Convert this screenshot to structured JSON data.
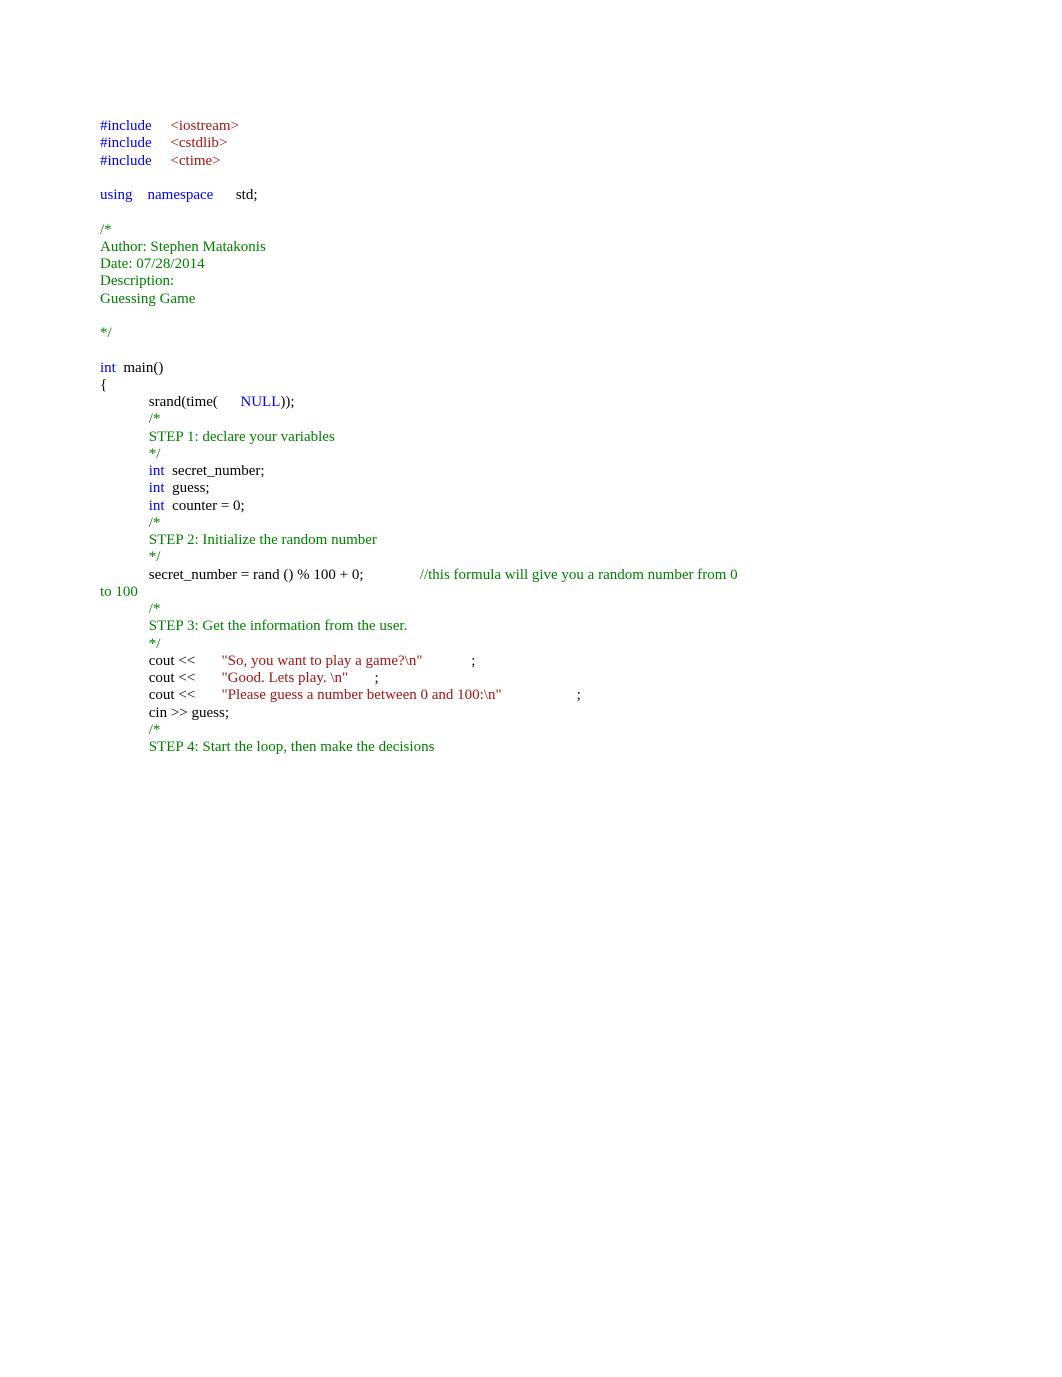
{
  "lines": [
    {
      "segments": [
        {
          "text": "#include",
          "class": "blue"
        },
        {
          "text": "     ",
          "class": "black"
        },
        {
          "text": "<iostream>",
          "class": "red"
        }
      ]
    },
    {
      "segments": [
        {
          "text": "#include",
          "class": "blue"
        },
        {
          "text": "     ",
          "class": "black"
        },
        {
          "text": "<cstdlib>",
          "class": "red"
        }
      ]
    },
    {
      "segments": [
        {
          "text": "#include",
          "class": "blue"
        },
        {
          "text": "     ",
          "class": "black"
        },
        {
          "text": "<ctime>",
          "class": "red"
        }
      ]
    },
    {
      "segments": [
        {
          "text": " ",
          "class": "black"
        }
      ]
    },
    {
      "segments": [
        {
          "text": "using",
          "class": "blue"
        },
        {
          "text": "    ",
          "class": "black"
        },
        {
          "text": "namespace",
          "class": "blue"
        },
        {
          "text": "      std;",
          "class": "black"
        }
      ]
    },
    {
      "segments": [
        {
          "text": " ",
          "class": "black"
        }
      ]
    },
    {
      "segments": [
        {
          "text": "/*",
          "class": "green"
        }
      ]
    },
    {
      "segments": [
        {
          "text": "Author: Stephen Matakonis",
          "class": "green"
        }
      ]
    },
    {
      "segments": [
        {
          "text": "Date: 07/28/2014",
          "class": "green"
        }
      ]
    },
    {
      "segments": [
        {
          "text": "Description:",
          "class": "green"
        }
      ]
    },
    {
      "segments": [
        {
          "text": "Guessing Game",
          "class": "green"
        }
      ]
    },
    {
      "segments": [
        {
          "text": " ",
          "class": "black"
        }
      ]
    },
    {
      "segments": [
        {
          "text": "*/",
          "class": "green"
        }
      ]
    },
    {
      "segments": [
        {
          "text": " ",
          "class": "black"
        }
      ]
    },
    {
      "segments": [
        {
          "text": "int",
          "class": "blue"
        },
        {
          "text": "  main()",
          "class": "black"
        }
      ]
    },
    {
      "segments": [
        {
          "text": "{",
          "class": "black"
        }
      ]
    },
    {
      "segments": [
        {
          "text": "             srand(time(      ",
          "class": "black"
        },
        {
          "text": "NULL",
          "class": "blue"
        },
        {
          "text": "));",
          "class": "black"
        }
      ]
    },
    {
      "segments": [
        {
          "text": "             ",
          "class": "black"
        },
        {
          "text": "/*",
          "class": "green"
        }
      ]
    },
    {
      "segments": [
        {
          "text": "             ",
          "class": "black"
        },
        {
          "text": "STEP 1: declare your variables",
          "class": "green"
        }
      ]
    },
    {
      "segments": [
        {
          "text": "             ",
          "class": "black"
        },
        {
          "text": "*/",
          "class": "green"
        }
      ]
    },
    {
      "segments": [
        {
          "text": "             ",
          "class": "black"
        },
        {
          "text": "int",
          "class": "blue"
        },
        {
          "text": "  secret_number;",
          "class": "black"
        }
      ]
    },
    {
      "segments": [
        {
          "text": "             ",
          "class": "black"
        },
        {
          "text": "int",
          "class": "blue"
        },
        {
          "text": "  guess;",
          "class": "black"
        }
      ]
    },
    {
      "segments": [
        {
          "text": "             ",
          "class": "black"
        },
        {
          "text": "int",
          "class": "blue"
        },
        {
          "text": "  counter = 0;",
          "class": "black"
        }
      ]
    },
    {
      "segments": [
        {
          "text": "             ",
          "class": "black"
        },
        {
          "text": "/*",
          "class": "green"
        }
      ]
    },
    {
      "segments": [
        {
          "text": "             ",
          "class": "black"
        },
        {
          "text": "STEP 2: Initialize the random number",
          "class": "green"
        }
      ]
    },
    {
      "segments": [
        {
          "text": "             ",
          "class": "black"
        },
        {
          "text": "*/",
          "class": "green"
        }
      ]
    },
    {
      "segments": [
        {
          "text": "             secret_number = rand () % 100 + 0;               ",
          "class": "black"
        },
        {
          "text": "//this formula will give you a random number from 0 ",
          "class": "green"
        }
      ]
    },
    {
      "segments": [
        {
          "text": "to 100",
          "class": "green"
        }
      ]
    },
    {
      "segments": [
        {
          "text": "             ",
          "class": "black"
        },
        {
          "text": "/*",
          "class": "green"
        }
      ]
    },
    {
      "segments": [
        {
          "text": "             ",
          "class": "black"
        },
        {
          "text": "STEP 3: Get the information from the user.",
          "class": "green"
        }
      ]
    },
    {
      "segments": [
        {
          "text": "             ",
          "class": "black"
        },
        {
          "text": "*/",
          "class": "green"
        }
      ]
    },
    {
      "segments": [
        {
          "text": "             cout <<       ",
          "class": "black"
        },
        {
          "text": "\"So, you want to play a game?\\n\"",
          "class": "red"
        },
        {
          "text": "             ;",
          "class": "black"
        }
      ]
    },
    {
      "segments": [
        {
          "text": "             cout <<       ",
          "class": "black"
        },
        {
          "text": "\"Good. Lets play. \\n\"",
          "class": "red"
        },
        {
          "text": "       ;",
          "class": "black"
        }
      ]
    },
    {
      "segments": [
        {
          "text": "             cout <<       ",
          "class": "black"
        },
        {
          "text": "\"Please guess a number between 0 and 100:\\n\"",
          "class": "red"
        },
        {
          "text": "                    ;",
          "class": "black"
        }
      ]
    },
    {
      "segments": [
        {
          "text": "             cin >> guess;",
          "class": "black"
        }
      ]
    },
    {
      "segments": [
        {
          "text": "             ",
          "class": "black"
        },
        {
          "text": "/*",
          "class": "green"
        }
      ]
    },
    {
      "segments": [
        {
          "text": "             ",
          "class": "black"
        },
        {
          "text": "STEP 4: Start the loop, then make the decisions",
          "class": "green"
        }
      ]
    }
  ]
}
